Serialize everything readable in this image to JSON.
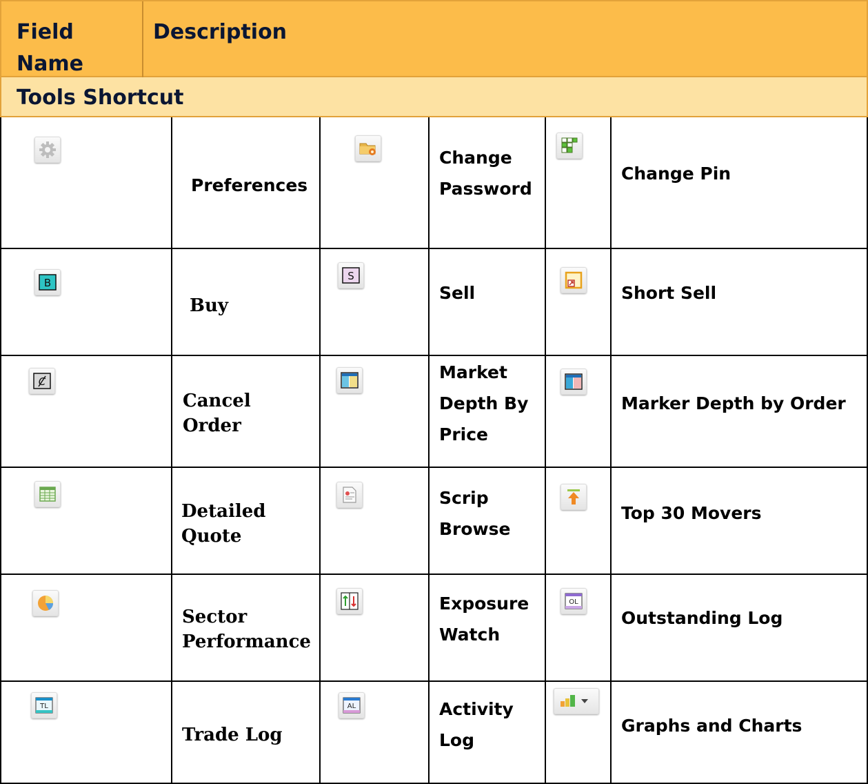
{
  "header": {
    "field_name": "Field Name",
    "description": "Description"
  },
  "section_title": "Tools Shortcut",
  "rows": [
    [
      {
        "icon": "gear-icon",
        "label": "Preferences"
      },
      {
        "icon": "folder-settings-icon",
        "label": "Change Password"
      },
      {
        "icon": "grid-pin-icon",
        "label": "Change Pin"
      }
    ],
    [
      {
        "icon": "buy-b-icon",
        "label": "Buy"
      },
      {
        "icon": "sell-s-icon",
        "label": "Sell"
      },
      {
        "icon": "short-sell-icon",
        "label": "Short Sell"
      }
    ],
    [
      {
        "icon": "cancel-order-icon",
        "label": "Cancel Order"
      },
      {
        "icon": "market-depth-price-icon",
        "label": "Market Depth By Price"
      },
      {
        "icon": "market-depth-order-icon",
        "label": "Marker Depth by Order"
      }
    ],
    [
      {
        "icon": "detailed-quote-table-icon",
        "label": "Detailed Quote"
      },
      {
        "icon": "scrip-browse-doc-icon",
        "label": "Scrip Browse"
      },
      {
        "icon": "top-movers-arrow-icon",
        "label": "Top 30 Movers"
      }
    ],
    [
      {
        "icon": "pie-chart-icon",
        "label": "Sector Performance"
      },
      {
        "icon": "exposure-watch-icon",
        "label": "Exposure Watch"
      },
      {
        "icon": "ol-log-icon",
        "label": "Outstanding Log"
      }
    ],
    [
      {
        "icon": "tl-log-icon",
        "label": "Trade Log"
      },
      {
        "icon": "al-log-icon",
        "label": "Activity Log"
      },
      {
        "icon": "bar-chart-dropdown-icon",
        "label": "Graphs and Charts"
      }
    ]
  ]
}
